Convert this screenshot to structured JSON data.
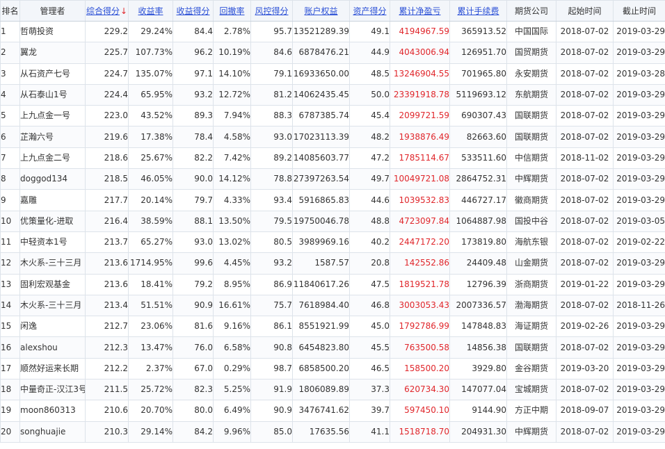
{
  "columns": [
    {
      "key": "rank",
      "label": "排名",
      "sortable": false
    },
    {
      "key": "manager",
      "label": "管理者",
      "sortable": false
    },
    {
      "key": "total_score",
      "label": "综合得分",
      "sortable": true,
      "arrow": "↓"
    },
    {
      "key": "return_rate",
      "label": "收益率",
      "sortable": true
    },
    {
      "key": "return_score",
      "label": "收益得分",
      "sortable": true
    },
    {
      "key": "drawdown",
      "label": "回撤率",
      "sortable": true
    },
    {
      "key": "risk_score",
      "label": "风控得分",
      "sortable": true
    },
    {
      "key": "equity",
      "label": "账户权益",
      "sortable": true
    },
    {
      "key": "asset_score",
      "label": "资产得分",
      "sortable": true
    },
    {
      "key": "net_profit",
      "label": "累计净盈亏",
      "sortable": true
    },
    {
      "key": "fees",
      "label": "累计手续费",
      "sortable": true
    },
    {
      "key": "broker",
      "label": "期货公司",
      "sortable": false
    },
    {
      "key": "start",
      "label": "起始时间",
      "sortable": false
    },
    {
      "key": "end",
      "label": "截止时间",
      "sortable": false
    }
  ],
  "rows": [
    [
      "1",
      "哲萌投资",
      "229.2",
      "29.24%",
      "84.4",
      "2.78%",
      "95.7",
      "13521289.39",
      "49.1",
      "4194967.59",
      "365913.52",
      "中国国际",
      "2018-07-02",
      "2019-03-29"
    ],
    [
      "2",
      "翼龙",
      "225.7",
      "107.73%",
      "96.2",
      "10.19%",
      "84.6",
      "6878476.21",
      "44.9",
      "4043006.94",
      "126951.70",
      "国贸期货",
      "2018-07-02",
      "2019-03-29"
    ],
    [
      "3",
      "从石资产七号",
      "224.7",
      "135.07%",
      "97.1",
      "14.10%",
      "79.1",
      "16933650.00",
      "48.5",
      "13246904.55",
      "701965.80",
      "永安期货",
      "2018-07-02",
      "2019-03-28"
    ],
    [
      "4",
      "从石泰山1号",
      "224.4",
      "65.95%",
      "93.2",
      "12.72%",
      "81.2",
      "14062435.45",
      "50.0",
      "23391918.78",
      "5119693.12",
      "东航期货",
      "2018-07-02",
      "2019-03-29"
    ],
    [
      "5",
      "上九点金一号",
      "223.0",
      "43.52%",
      "89.3",
      "7.94%",
      "88.3",
      "6787385.74",
      "45.4",
      "2099721.59",
      "690307.43",
      "国联期货",
      "2018-07-02",
      "2019-03-29"
    ],
    [
      "6",
      "芷瀚六号",
      "219.6",
      "17.38%",
      "78.4",
      "4.58%",
      "93.0",
      "17023113.39",
      "48.2",
      "1938876.49",
      "82663.60",
      "国联期货",
      "2018-07-02",
      "2019-03-29"
    ],
    [
      "7",
      "上九点金二号",
      "218.6",
      "25.67%",
      "82.2",
      "7.42%",
      "89.2",
      "14085603.77",
      "47.2",
      "1785114.67",
      "533511.60",
      "中信期货",
      "2018-11-02",
      "2019-03-29"
    ],
    [
      "8",
      "doggod134",
      "218.5",
      "46.05%",
      "90.0",
      "14.12%",
      "78.8",
      "27397263.54",
      "49.7",
      "10049721.08",
      "2864752.31",
      "中辉期货",
      "2018-07-02",
      "2019-03-29"
    ],
    [
      "9",
      "嘉雕",
      "217.7",
      "20.14%",
      "79.7",
      "4.33%",
      "93.4",
      "5916865.83",
      "44.6",
      "1039532.83",
      "446727.17",
      "徽商期货",
      "2018-07-02",
      "2019-03-29"
    ],
    [
      "10",
      "优策量化-进取",
      "216.4",
      "38.59%",
      "88.1",
      "13.50%",
      "79.5",
      "19750046.78",
      "48.8",
      "4723097.84",
      "1064887.98",
      "国投中谷",
      "2018-07-02",
      "2019-03-05"
    ],
    [
      "11",
      "中轻资本1号",
      "213.7",
      "65.27%",
      "93.0",
      "13.02%",
      "80.5",
      "3989969.16",
      "40.2",
      "2447172.20",
      "173819.80",
      "海航东银",
      "2018-07-02",
      "2019-02-22"
    ],
    [
      "12",
      "木火系-三十三月",
      "213.6",
      "1714.95%",
      "99.6",
      "4.45%",
      "93.2",
      "1587.57",
      "20.8",
      "142552.86",
      "24409.48",
      "山金期货",
      "2018-07-02",
      "2019-03-29"
    ],
    [
      "13",
      "固利宏观基金",
      "213.6",
      "18.41%",
      "79.2",
      "8.95%",
      "86.9",
      "11840617.26",
      "47.5",
      "1819521.78",
      "12796.39",
      "浙商期货",
      "2019-01-22",
      "2019-03-29"
    ],
    [
      "14",
      "木火系-三十三月",
      "213.4",
      "51.51%",
      "90.9",
      "16.61%",
      "75.7",
      "7618984.40",
      "46.8",
      "3003053.43",
      "2007336.57",
      "渤海期货",
      "2018-07-02",
      "2018-11-26"
    ],
    [
      "15",
      "闲逸",
      "212.7",
      "23.06%",
      "81.6",
      "9.16%",
      "86.1",
      "8551921.99",
      "45.0",
      "1792786.99",
      "147848.83",
      "海证期货",
      "2019-02-26",
      "2019-03-29"
    ],
    [
      "16",
      "alexshou",
      "212.3",
      "13.47%",
      "76.0",
      "6.58%",
      "90.8",
      "6454823.80",
      "45.5",
      "763500.58",
      "14856.38",
      "国联期货",
      "2018-07-02",
      "2019-03-29"
    ],
    [
      "17",
      "顺然好运来长期",
      "212.2",
      "2.37%",
      "67.0",
      "0.29%",
      "98.7",
      "6858500.20",
      "46.5",
      "158500.20",
      "3929.80",
      "金谷期货",
      "2019-03-20",
      "2019-03-29"
    ],
    [
      "18",
      "中量奇正-汉江3号",
      "211.5",
      "25.72%",
      "82.3",
      "5.25%",
      "91.9",
      "1806089.89",
      "37.3",
      "620734.30",
      "147077.04",
      "宝城期货",
      "2018-07-02",
      "2019-03-29"
    ],
    [
      "19",
      "moon860313",
      "210.6",
      "20.70%",
      "80.0",
      "6.49%",
      "90.9",
      "3476741.62",
      "39.7",
      "597450.10",
      "9144.90",
      "方正中期",
      "2018-09-07",
      "2019-03-29"
    ],
    [
      "20",
      "songhuajie",
      "210.3",
      "29.14%",
      "84.2",
      "9.96%",
      "85.0",
      "17635.56",
      "41.1",
      "1518718.70",
      "204931.30",
      "中辉期货",
      "2018-07-02",
      "2019-03-29"
    ]
  ],
  "colors": {
    "link": "#2a4fd6",
    "profit": "#e0262b",
    "sort_arrow": "#e0262b"
  }
}
